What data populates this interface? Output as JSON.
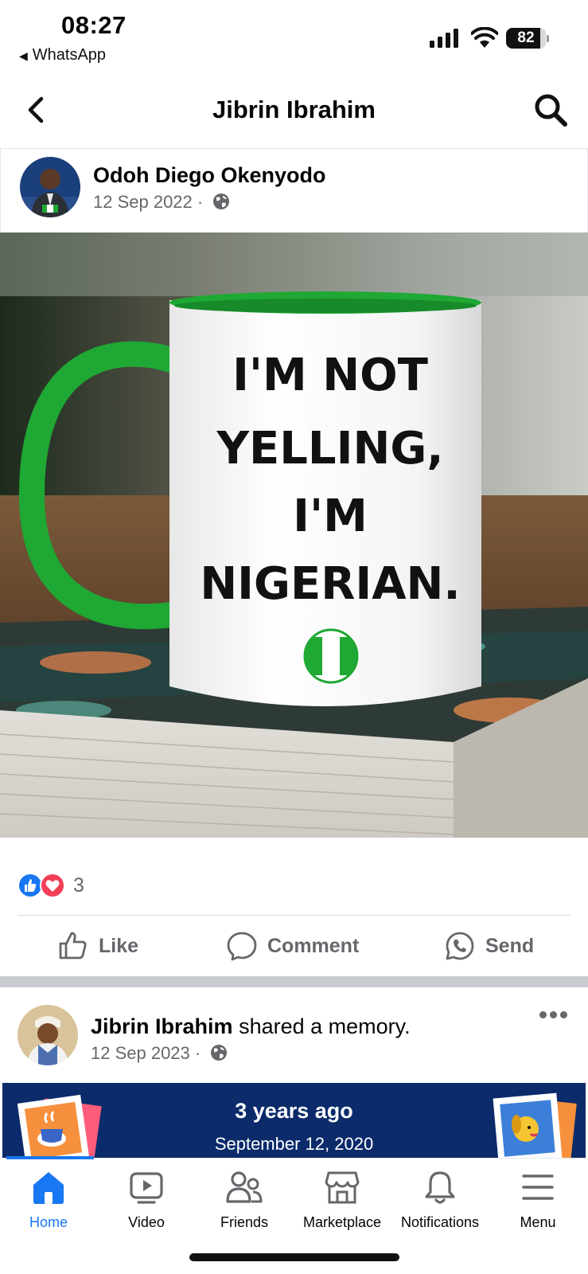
{
  "status_bar": {
    "time": "08:27",
    "back_app": "WhatsApp",
    "battery": "82"
  },
  "header": {
    "title": "Jibrin Ibrahim"
  },
  "post1": {
    "author": "Odoh Diego Okenyodo",
    "date": "12 Sep 2022 ·",
    "image_text": [
      "I'M NOT",
      "YELLING,",
      "I'M",
      "NIGERIAN."
    ],
    "reaction_count": "3",
    "actions": {
      "like": "Like",
      "comment": "Comment",
      "send": "Send"
    }
  },
  "post2": {
    "author": "Jibrin Ibrahim",
    "action_text": "shared a memory.",
    "date": "12 Sep 2023 ·",
    "memory": {
      "headline": "3 years ago",
      "date": "September 12, 2020"
    }
  },
  "bottom_nav": {
    "tabs": [
      {
        "label": "Home",
        "icon": "home-icon",
        "active": true
      },
      {
        "label": "Video",
        "icon": "video-icon"
      },
      {
        "label": "Friends",
        "icon": "friends-icon"
      },
      {
        "label": "Marketplace",
        "icon": "marketplace-icon"
      },
      {
        "label": "Notifications",
        "icon": "bell-icon"
      },
      {
        "label": "Menu",
        "icon": "menu-icon"
      }
    ]
  },
  "colors": {
    "accent": "#1877f2",
    "memory_bg": "#0b2b6b",
    "mug_green": "#1fa834",
    "love": "#f33e58"
  }
}
